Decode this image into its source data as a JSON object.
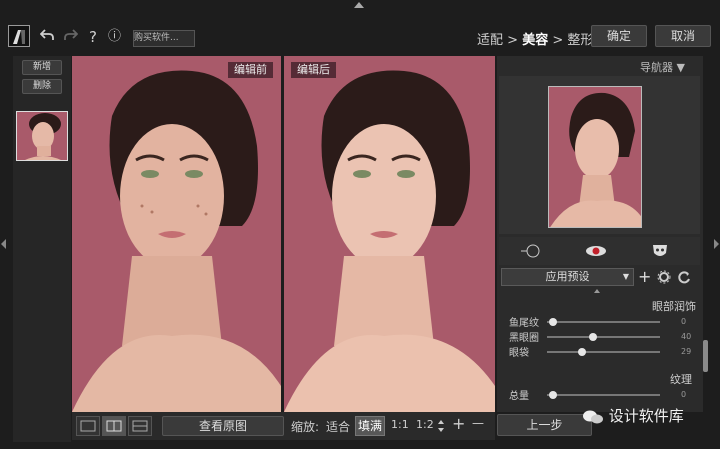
{
  "toolbar": {
    "undo_icon": "undo-icon",
    "redo_icon": "redo-icon",
    "help": "?",
    "info": "ⓘ",
    "buy_label": "购买软件...",
    "steps": [
      "适配",
      ">",
      "美容",
      ">",
      "整形"
    ],
    "active_step": "美容",
    "confirm_label": "确定",
    "cancel_label": "取消"
  },
  "left_panel": {
    "add_label": "新增",
    "delete_label": "删除"
  },
  "compare": {
    "before_label": "编辑前",
    "after_label": "编辑后"
  },
  "bottombar": {
    "view_original_label": "查看原图",
    "zoom_label": "缩放:",
    "fit_label": "适合",
    "fill_label": "填满",
    "ratio_1": "1:1",
    "ratio_2": "1:2",
    "plus": "+",
    "minus": "—"
  },
  "right_panel": {
    "navigator_title": "导航器 ▼",
    "preset_label": "应用预设",
    "eye_section": "眼部润饰",
    "sliders_eye": [
      {
        "label": "鱼尾纹",
        "value": "0",
        "fraction": 0.0
      },
      {
        "label": "黑眼圈",
        "value": "40",
        "fraction": 0.4
      },
      {
        "label": "眼袋",
        "value": "29",
        "fraction": 0.29
      }
    ],
    "texture_section": "纹理",
    "sliders_texture": [
      {
        "label": "总量",
        "value": "0",
        "fraction": 0.0
      }
    ],
    "prev_label": "上一步"
  },
  "watermark": "设计软件库",
  "colors": {
    "background": "#1d1d1d",
    "photo_bg": "#a95a6a",
    "panel": "#2b2b2b"
  }
}
